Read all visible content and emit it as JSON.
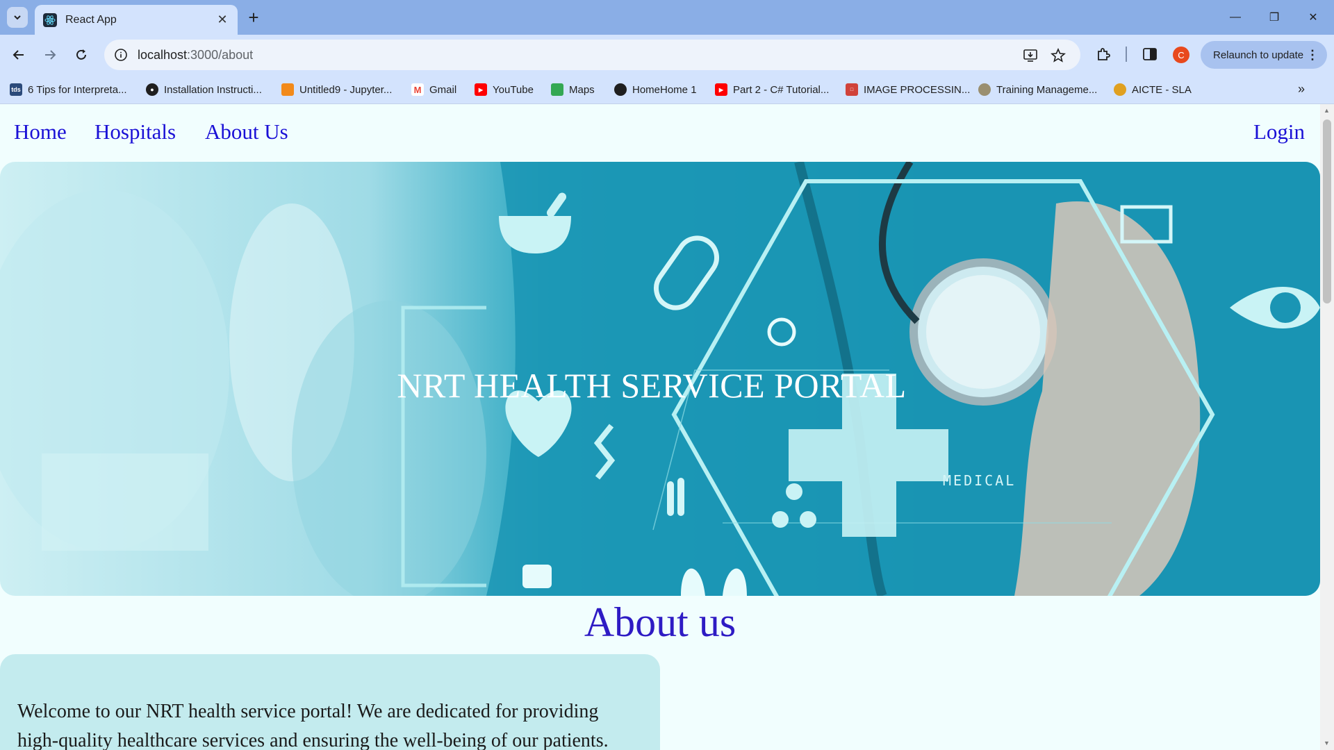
{
  "browser": {
    "tab_title": "React App",
    "url_host": "localhost",
    "url_path": ":3000/about",
    "profile_initial": "C",
    "relaunch_label": "Relaunch to update",
    "bookmarks": [
      {
        "label": "6 Tips for Interpreta...",
        "icon": "tds-icon",
        "color": "#2b4a7a"
      },
      {
        "label": "Installation Instructi...",
        "icon": "github-icon",
        "color": "#1f1f1f"
      },
      {
        "label": "Untitled9 - Jupyter...",
        "icon": "jupyter-icon",
        "color": "#f28a1a"
      },
      {
        "label": "Gmail",
        "icon": "gmail-icon",
        "color": "#ea4335"
      },
      {
        "label": "YouTube",
        "icon": "youtube-icon",
        "color": "#ff0000"
      },
      {
        "label": "Maps",
        "icon": "maps-icon",
        "color": "#34a853"
      },
      {
        "label": "HomeHome 1",
        "icon": "globe-icon",
        "color": "#1f1f1f"
      },
      {
        "label": "Part 2 - C# Tutorial...",
        "icon": "youtube-icon",
        "color": "#ff0000"
      },
      {
        "label": "IMAGE PROCESSIN...",
        "icon": "doc-icon",
        "color": "#d0423a"
      },
      {
        "label": "Training Manageme...",
        "icon": "training-icon",
        "color": "#9a8f70"
      },
      {
        "label": "AICTE - SLA",
        "icon": "aicte-icon",
        "color": "#e0a020"
      }
    ]
  },
  "nav": {
    "home": "Home",
    "hospitals": "Hospitals",
    "about": "About Us",
    "login": "Login"
  },
  "hero": {
    "title": "NRT HEALTH SERVICE PORTAL",
    "medical_label": "MEDICAL"
  },
  "about": {
    "heading": "About us",
    "paragraph": "Welcome to our NRT health service portal! We are dedicated for providing high-quality healthcare services and ensuring the well-being of our patients."
  },
  "colors": {
    "link": "#1a10d6",
    "heading": "#2e1bc4",
    "page_bg": "#f1fefe",
    "card_bg": "#c3ebee",
    "hero_teal": "#1790b0"
  }
}
